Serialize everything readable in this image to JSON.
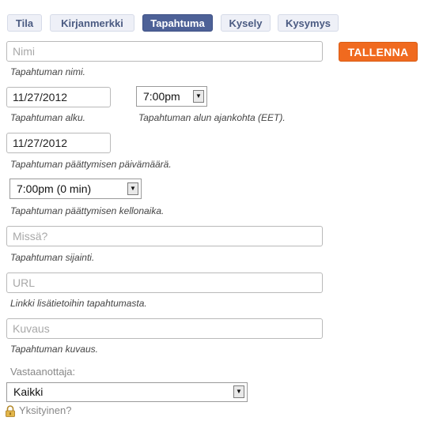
{
  "tabs": [
    {
      "label": "Tila"
    },
    {
      "label": "Kirjanmerkki"
    },
    {
      "label": "Tapahtuma",
      "active": true
    },
    {
      "label": "Kysely"
    },
    {
      "label": "Kysymys"
    }
  ],
  "name": {
    "placeholder": "Nimi",
    "help": "Tapahtuman nimi."
  },
  "save_label": "TALLENNA",
  "start": {
    "date": "11/27/2012",
    "date_help": "Tapahtuman alku.",
    "time": "7:00pm",
    "time_help": "Tapahtuman alun ajankohta (EET)."
  },
  "end": {
    "date": "11/27/2012",
    "date_help": "Tapahtuman päättymisen päivämäärä.",
    "time": "7:00pm (0 min)",
    "time_help": "Tapahtuman päättymisen kellonaika."
  },
  "location": {
    "placeholder": "Missä?",
    "help": "Tapahtuman sijainti."
  },
  "url": {
    "placeholder": "URL",
    "help": "Linkki lisätietoihin tapahtumasta."
  },
  "description": {
    "placeholder": "Kuvaus",
    "help": "Tapahtuman kuvaus."
  },
  "recipient": {
    "label": "Vastaanottaja:",
    "value": "Kaikki"
  },
  "private_label": "Yksityinen?",
  "colors": {
    "accent": "#4d6197",
    "save": "#f06a1f"
  },
  "icons": {
    "private": "lock-icon",
    "dropdown": "dropdown-arrow-icon"
  }
}
